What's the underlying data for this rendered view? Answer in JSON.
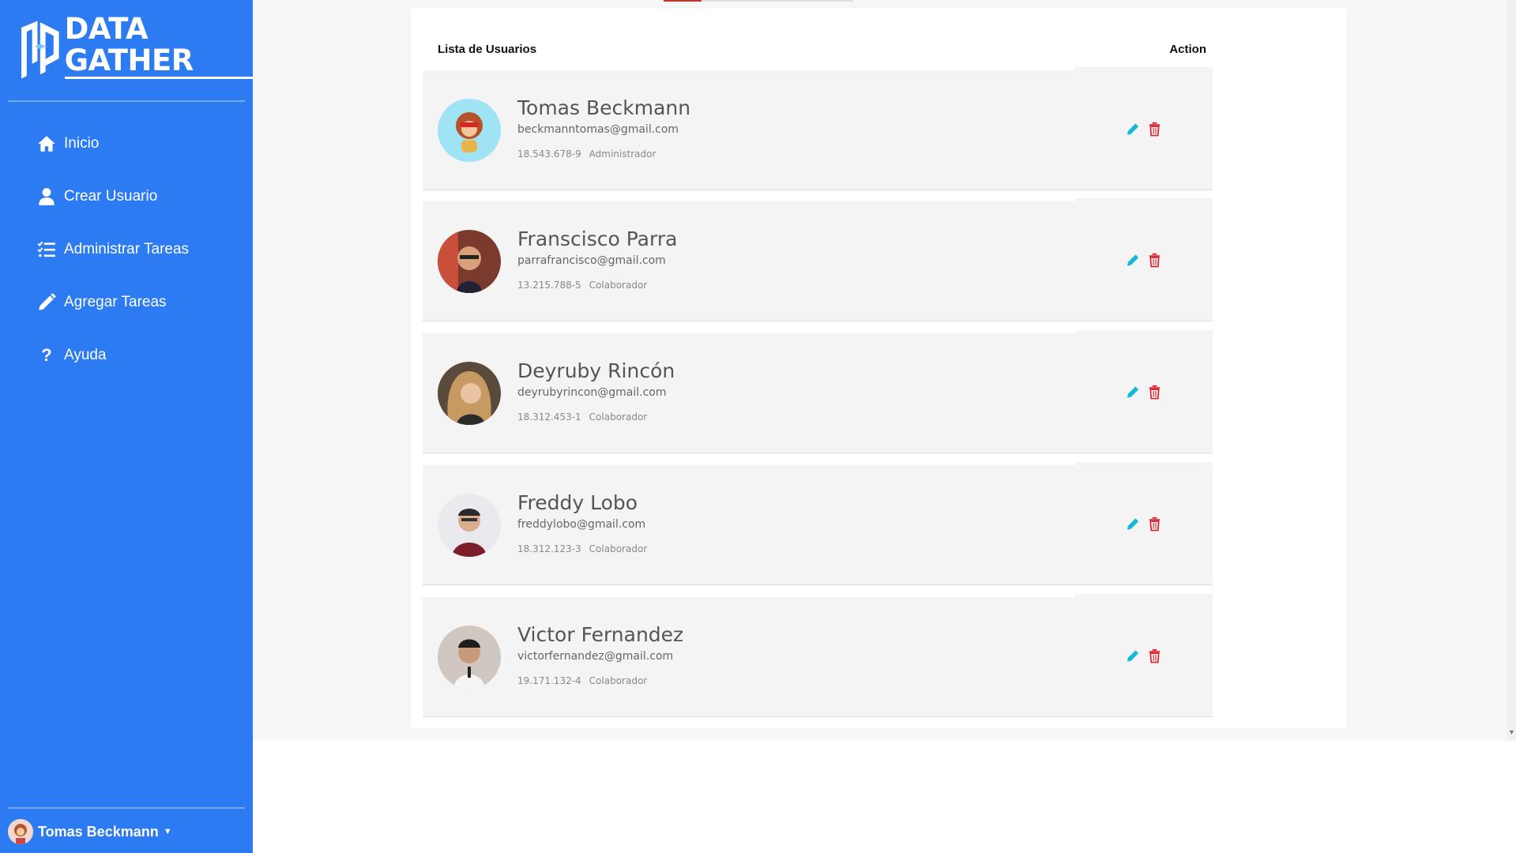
{
  "app": {
    "logo_text": "DATA GATHER"
  },
  "sidebar": {
    "items": [
      {
        "label": "Inicio",
        "icon": "home-icon"
      },
      {
        "label": "Crear Usuario",
        "icon": "user-icon"
      },
      {
        "label": "Administrar Tareas",
        "icon": "task-list-icon"
      },
      {
        "label": "Agregar Tareas",
        "icon": "pencil-icon"
      },
      {
        "label": "Ayuda",
        "icon": "question-icon"
      }
    ],
    "current_user": "Tomas Beckmann"
  },
  "list": {
    "title": "Lista de Usuarios",
    "action_header": "Action",
    "users": [
      {
        "name": "Tomas Beckmann",
        "email": "beckmanntomas@gmail.com",
        "rut": "18.543.678-9",
        "role": "Administrador"
      },
      {
        "name": "Franscisco Parra",
        "email": "parrafrancisco@gmail.com",
        "rut": "13.215.788-5",
        "role": "Colaborador"
      },
      {
        "name": "Deyruby Rincón",
        "email": "deyrubyrincon@gmail.com",
        "rut": "18.312.453-1",
        "role": "Colaborador"
      },
      {
        "name": "Freddy Lobo",
        "email": "freddylobo@gmail.com",
        "rut": "18.312.123-3",
        "role": "Colaborador"
      },
      {
        "name": "Victor Fernandez",
        "email": "victorfernandez@gmail.com",
        "rut": "19.171.132-4",
        "role": "Colaborador"
      }
    ]
  },
  "colors": {
    "sidebar": "#2c7bf2",
    "edit": "#17b8d6",
    "delete": "#d9242f"
  }
}
